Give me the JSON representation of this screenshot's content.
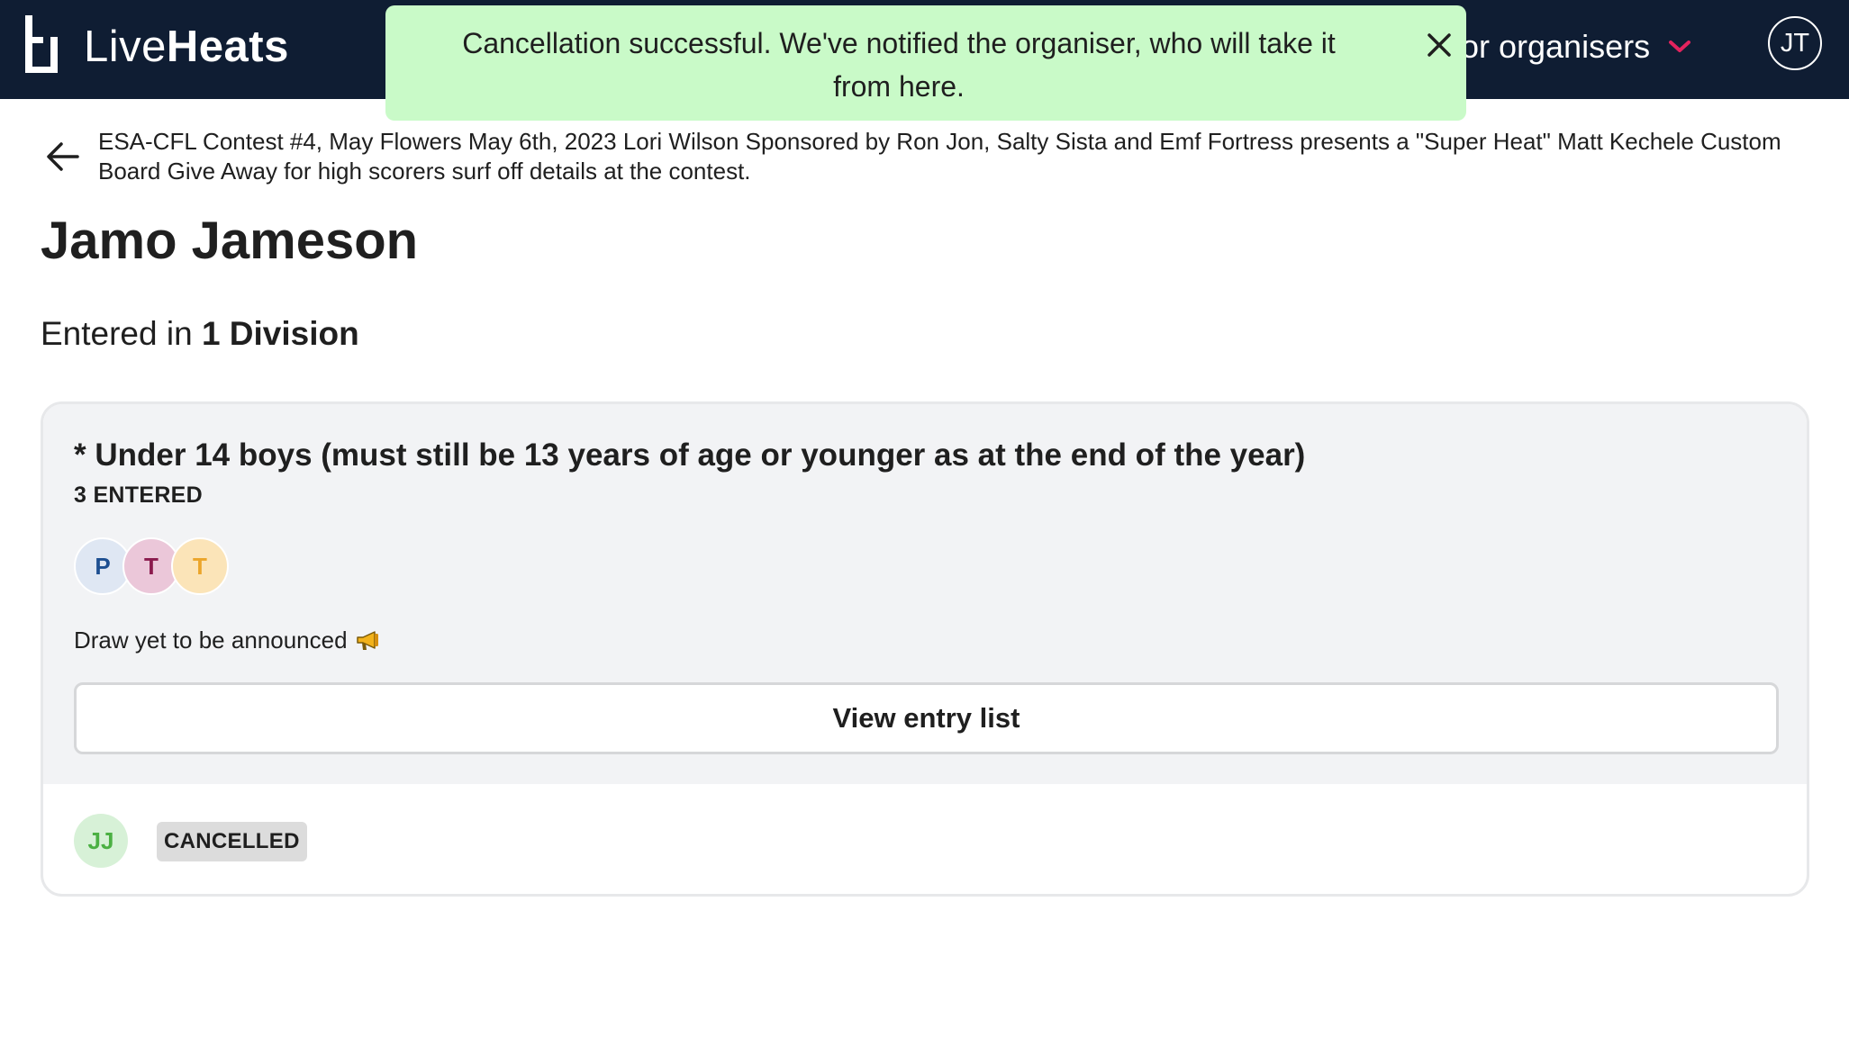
{
  "app": {
    "logo_light": "Live",
    "logo_bold": "Heats",
    "nav_organisers": "For organisers",
    "user_initials": "JT"
  },
  "toast": {
    "message": "Cancellation successful. We've notified the organiser, who will take it from here."
  },
  "event": {
    "title": "ESA-CFL Contest #4, May Flowers May 6th, 2023 Lori Wilson Sponsored by Ron Jon, Salty Sista and Emf Fortress presents a \"Super Heat\" Matt Kechele Custom Board Give Away for high scorers surf off details at the contest."
  },
  "athlete": {
    "name": "Jamo Jameson",
    "entered_prefix": "Entered in",
    "entered_count": "1 Division"
  },
  "division": {
    "title": "* Under 14 boys (must still be 13 years of age or younger as at the end of the year)",
    "entered_label": "3 ENTERED",
    "avatars": [
      "P",
      "T",
      "T"
    ],
    "draw_text": "Draw yet to be announced",
    "view_button": "View entry list",
    "entry_initials": "JJ",
    "entry_status": "CANCELLED"
  },
  "colors": {
    "topbar": "#0f1d33",
    "toast_bg": "#c9fac8",
    "accent_chevron": "#e4235e"
  },
  "icons": {
    "logo": "liveheats-logo-icon",
    "close": "close-icon",
    "back": "arrow-left-icon",
    "dropdown": "chevron-down-icon",
    "megaphone": "megaphone-icon"
  }
}
